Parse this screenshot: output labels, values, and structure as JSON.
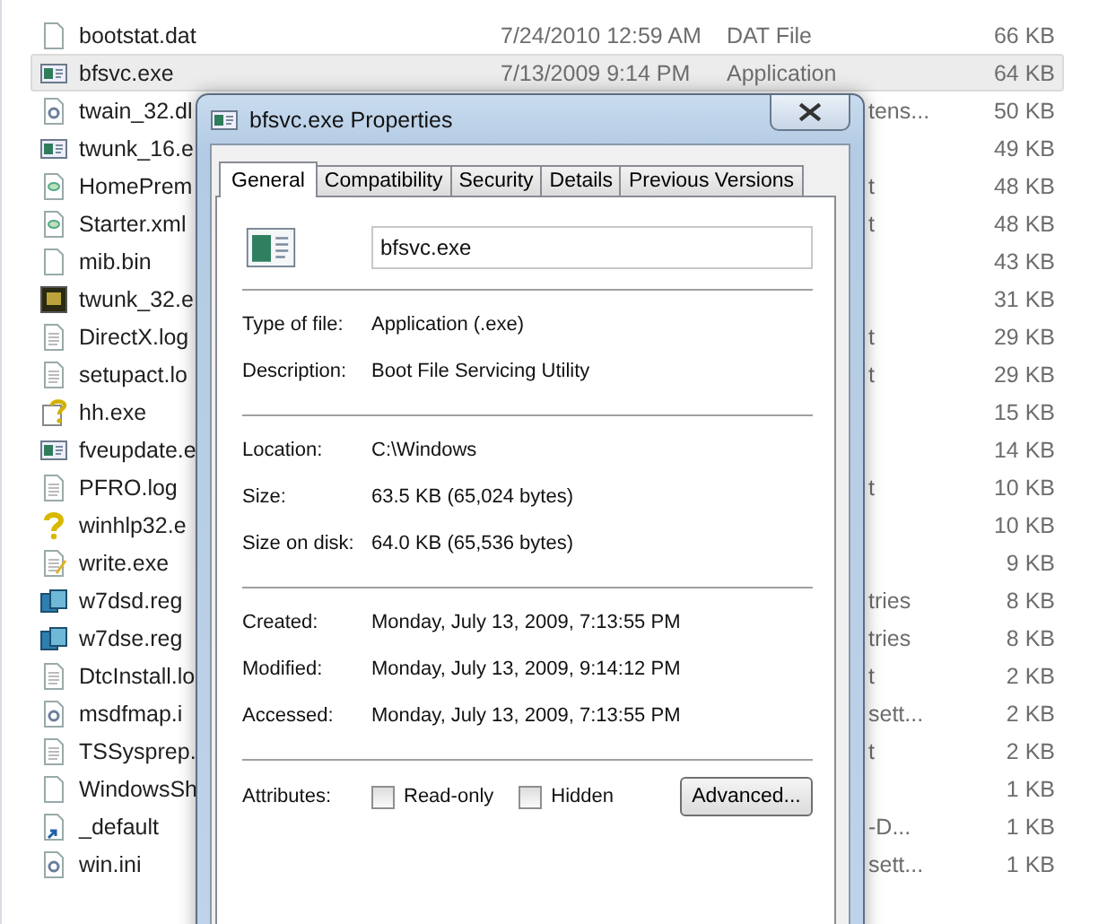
{
  "file_list": {
    "rows": [
      {
        "kind": "blank",
        "name": "bootstat.dat",
        "date": "7/24/2010 12:59 AM",
        "type": "DAT File",
        "size": "66 KB",
        "selected": false
      },
      {
        "kind": "app",
        "name": "bfsvc.exe",
        "date": "7/13/2009 9:14 PM",
        "type": "Application",
        "size": "64 KB",
        "selected": true
      },
      {
        "kind": "dll",
        "name": "twain_32.dl",
        "type": "tens...",
        "size": "50 KB",
        "selected": false
      },
      {
        "kind": "app",
        "name": "twunk_16.e",
        "size": "49 KB",
        "selected": false
      },
      {
        "kind": "xml",
        "name": "HomePrem",
        "type": "t",
        "size": "48 KB",
        "selected": false
      },
      {
        "kind": "xml",
        "name": "Starter.xml",
        "type": "t",
        "size": "48 KB",
        "selected": false
      },
      {
        "kind": "blank",
        "name": "mib.bin",
        "size": "43 KB",
        "selected": false
      },
      {
        "kind": "scanner",
        "name": "twunk_32.e",
        "size": "31 KB",
        "selected": false
      },
      {
        "kind": "text",
        "name": "DirectX.log",
        "type": "t",
        "size": "29 KB",
        "selected": false
      },
      {
        "kind": "text",
        "name": "setupact.lo",
        "type": "t",
        "size": "29 KB",
        "selected": false
      },
      {
        "kind": "help",
        "name": "hh.exe",
        "size": "15 KB",
        "selected": false
      },
      {
        "kind": "app",
        "name": "fveupdate.e",
        "size": "14 KB",
        "selected": false
      },
      {
        "kind": "text",
        "name": "PFRO.log",
        "type": "t",
        "size": "10 KB",
        "selected": false
      },
      {
        "kind": "question",
        "name": "winhlp32.e",
        "size": "10 KB",
        "selected": false
      },
      {
        "kind": "write",
        "name": "write.exe",
        "size": "9 KB",
        "selected": false
      },
      {
        "kind": "registry",
        "name": "w7dsd.reg",
        "type": "tries",
        "size": "8 KB",
        "selected": false
      },
      {
        "kind": "registry",
        "name": "w7dse.reg",
        "type": "tries",
        "size": "8 KB",
        "selected": false
      },
      {
        "kind": "text",
        "name": "DtcInstall.lo",
        "type": "t",
        "size": "2 KB",
        "selected": false
      },
      {
        "kind": "settings",
        "name": "msdfmap.i",
        "type": "sett...",
        "size": "2 KB",
        "selected": false
      },
      {
        "kind": "text",
        "name": "TSSysprep.",
        "type": "t",
        "size": "2 KB",
        "selected": false
      },
      {
        "kind": "blank",
        "name": "WindowsSh",
        "size": "1 KB",
        "selected": false
      },
      {
        "kind": "shortcut",
        "name": "_default",
        "type": "-D...",
        "size": "1 KB",
        "selected": false
      },
      {
        "kind": "settings",
        "name": "win.ini",
        "type": "sett...",
        "size": "1 KB",
        "selected": false
      }
    ]
  },
  "dialog": {
    "title": "bfsvc.exe Properties",
    "tabs": [
      {
        "label": "General",
        "selected": true
      },
      {
        "label": "Compatibility",
        "selected": false
      },
      {
        "label": "Security",
        "selected": false
      },
      {
        "label": "Details",
        "selected": false
      },
      {
        "label": "Previous Versions",
        "selected": false
      }
    ],
    "file_name": "bfsvc.exe",
    "groups": [
      [
        {
          "label": "Type of file:",
          "value": "Application (.exe)"
        },
        {
          "label": "Description:",
          "value": "Boot File Servicing Utility"
        }
      ],
      [
        {
          "label": "Location:",
          "value": "C:\\Windows"
        },
        {
          "label": "Size:",
          "value": "63.5 KB (65,024 bytes)"
        },
        {
          "label": "Size on disk:",
          "value": "64.0 KB (65,536 bytes)"
        }
      ],
      [
        {
          "label": "Created:",
          "value": "Monday, July 13, 2009, 7:13:55 PM"
        },
        {
          "label": "Modified:",
          "value": "Monday, July 13, 2009, 9:14:12 PM"
        },
        {
          "label": "Accessed:",
          "value": "Monday, July 13, 2009, 7:13:55 PM"
        }
      ]
    ],
    "attributes": {
      "label": "Attributes:",
      "checkboxes": [
        {
          "label": "Read-only",
          "checked": false
        },
        {
          "label": "Hidden",
          "checked": false
        }
      ],
      "button": "Advanced..."
    }
  }
}
